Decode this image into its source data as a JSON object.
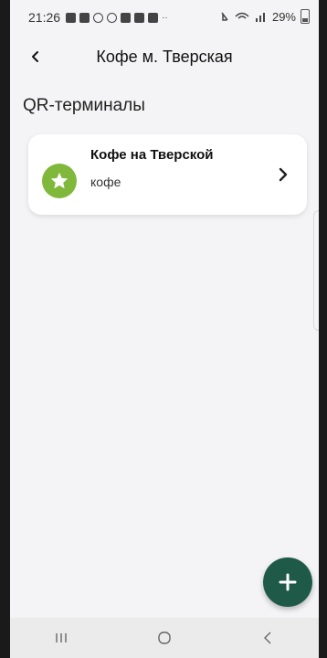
{
  "status_bar": {
    "time": "21:26",
    "battery_text": "29%",
    "icons": [
      "message-icon",
      "game-icon",
      "wifi-calling-icon",
      "rss-icon",
      "photo-icon",
      "chat-icon",
      "gallery-icon",
      "more-dots-icon",
      "mute-icon",
      "volte-icon",
      "signal-icon",
      "battery-icon"
    ]
  },
  "app_bar": {
    "back_icon": "chevron-left-icon",
    "title": "Кофе м. Тверская"
  },
  "section": {
    "title": "QR-терминалы"
  },
  "terminals": [
    {
      "title": "Кофе на Тверской",
      "subtitle": "кофе",
      "avatar_icon": "star-icon",
      "avatar_color": "#7fb83a",
      "chevron_icon": "chevron-right-icon"
    }
  ],
  "fab": {
    "icon": "plus-icon",
    "color": "#1f5a48"
  },
  "nav_bar": {
    "items": [
      "recent-apps-icon",
      "home-icon",
      "back-icon"
    ]
  }
}
